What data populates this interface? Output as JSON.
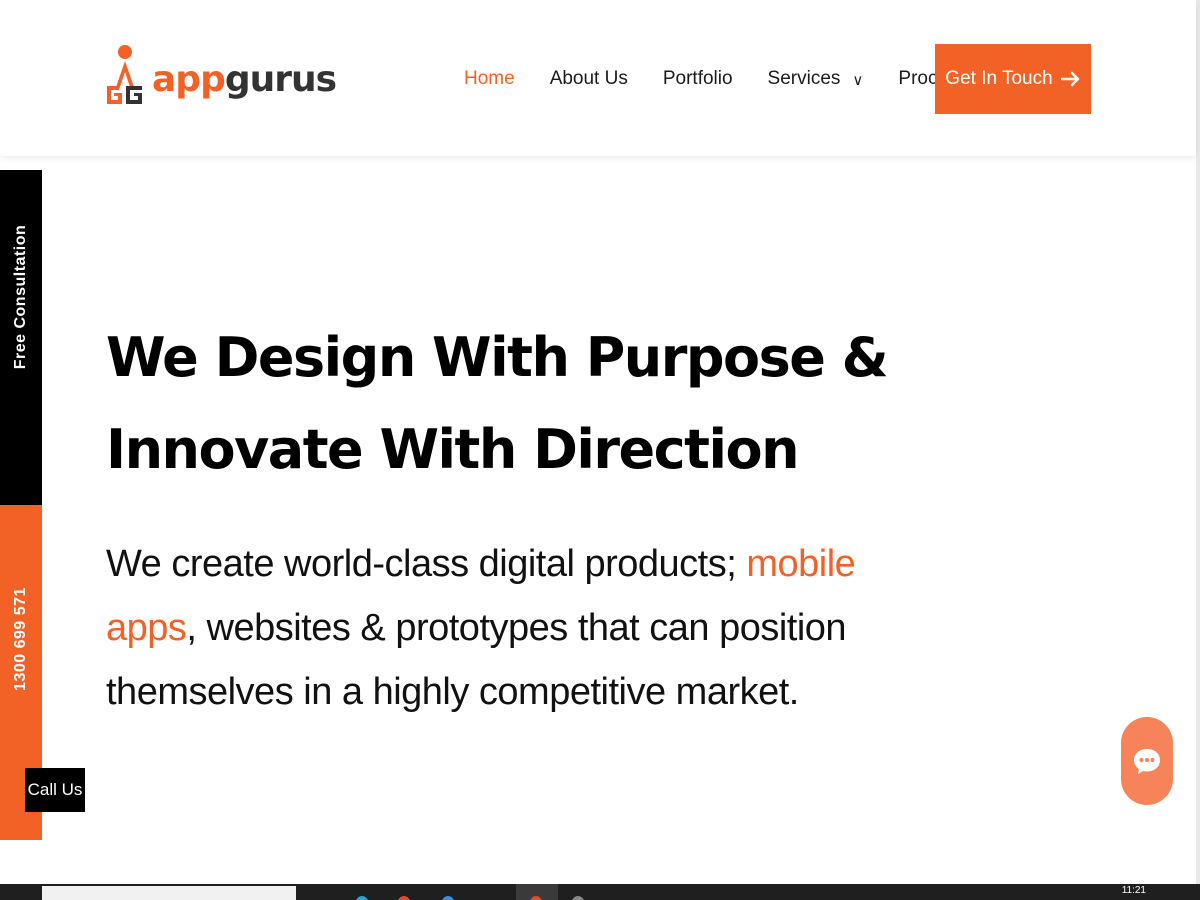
{
  "brand": {
    "logo_app": "app",
    "logo_gurus": "gurus",
    "accent_color": "#f26227",
    "dark_color": "#333333"
  },
  "nav": {
    "items": [
      {
        "label": "Home",
        "active": true
      },
      {
        "label": "About Us",
        "active": false
      },
      {
        "label": "Portfolio",
        "active": false
      },
      {
        "label": "Services",
        "active": false,
        "has_dropdown": true
      },
      {
        "label": "Process",
        "active": false
      }
    ],
    "dropdown_icon": "chevron-down-icon"
  },
  "cta": {
    "label": "Get In Touch",
    "icon": "arrow-right-icon"
  },
  "side": {
    "consultation_label": "Free Consultation",
    "phone": "1300 699 571",
    "call_label": "Call Us"
  },
  "hero": {
    "title": "We Design With Purpose & Innovate With Direction",
    "subtitle_before": "We create world-class digital products; ",
    "subtitle_accent": "mobile apps",
    "subtitle_after": ", websites & prototypes that can position themselves in a highly competitive market."
  },
  "chat": {
    "icon": "chat-bubble-icon"
  },
  "taskbar": {
    "clock": "11:21"
  }
}
